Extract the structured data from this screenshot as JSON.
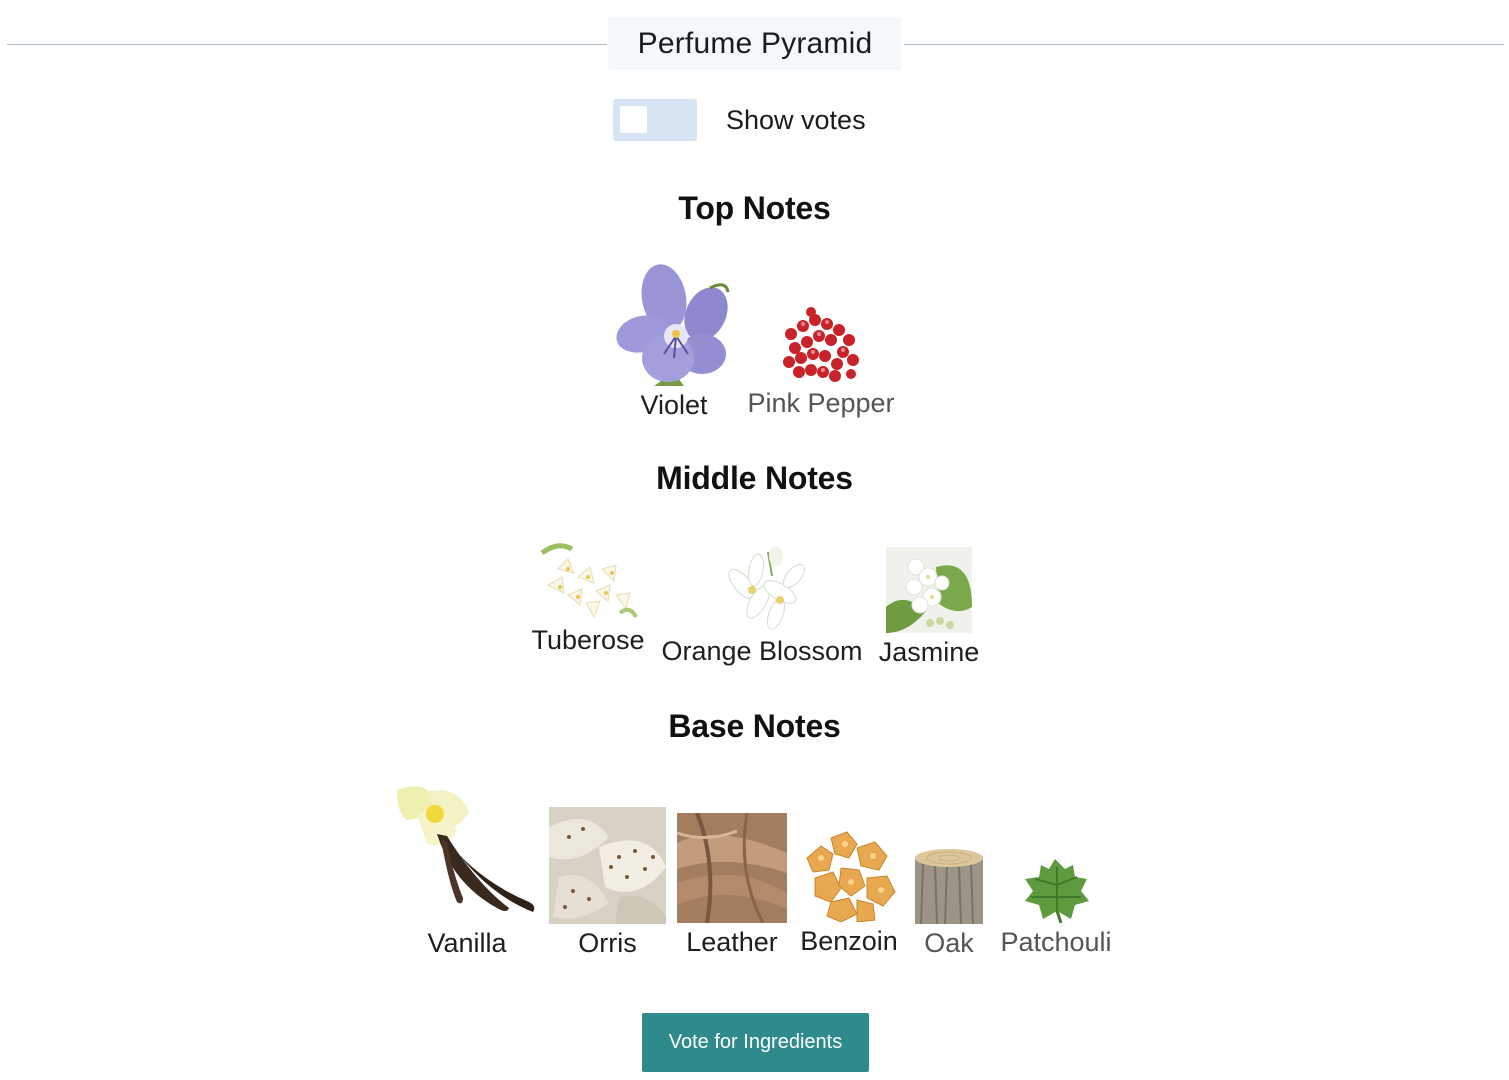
{
  "title": "Perfume Pyramid",
  "toggle": {
    "label": "Show votes",
    "checked": false
  },
  "sections": {
    "top": {
      "title": "Top Notes",
      "notes": [
        {
          "label": "Violet",
          "icon": "violet-flower-icon"
        },
        {
          "label": "Pink Pepper",
          "icon": "pink-pepper-icon"
        }
      ]
    },
    "middle": {
      "title": "Middle Notes",
      "notes": [
        {
          "label": "Tuberose",
          "icon": "tuberose-flower-icon"
        },
        {
          "label": "Orange Blossom",
          "icon": "orange-blossom-icon"
        },
        {
          "label": "Jasmine",
          "icon": "jasmine-flower-icon"
        }
      ]
    },
    "base": {
      "title": "Base Notes",
      "notes": [
        {
          "label": "Vanilla",
          "icon": "vanilla-icon"
        },
        {
          "label": "Orris",
          "icon": "orris-root-icon"
        },
        {
          "label": "Leather",
          "icon": "leather-icon"
        },
        {
          "label": "Benzoin",
          "icon": "benzoin-resin-icon"
        },
        {
          "label": "Oak",
          "icon": "oak-log-icon"
        },
        {
          "label": "Patchouli",
          "icon": "patchouli-leaf-icon"
        }
      ]
    }
  },
  "vote_button": {
    "label": "Vote for Ingredients",
    "color": "#2f8a8c"
  }
}
